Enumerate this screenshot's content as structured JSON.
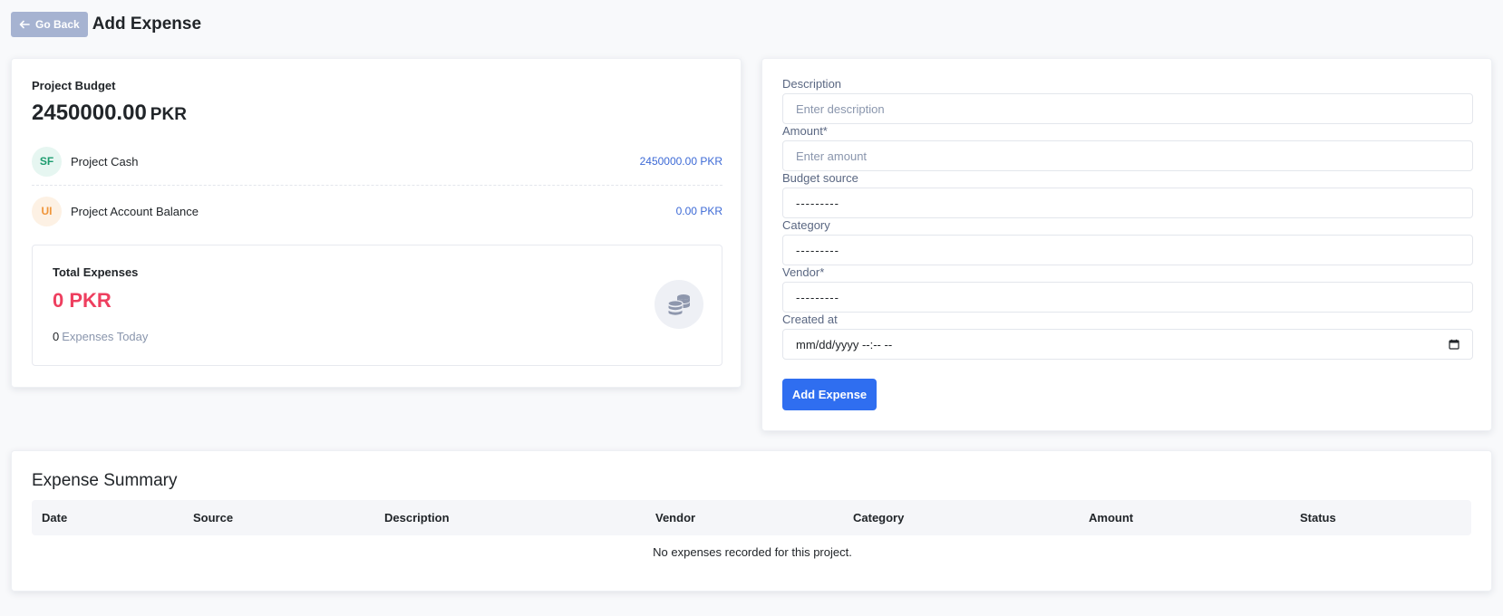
{
  "header": {
    "back_label": "Go Back",
    "title": "Add Expense"
  },
  "budget": {
    "label": "Project Budget",
    "value": "2450000.00",
    "currency": "PKR",
    "accounts": [
      {
        "initials": "SF",
        "name": "Project Cash",
        "amount": "2450000.00 PKR"
      },
      {
        "initials": "UI",
        "name": "Project Account Balance",
        "amount": "0.00 PKR"
      }
    ],
    "total": {
      "label": "Total Expenses",
      "value": "0 PKR",
      "today_count": "0",
      "today_label": "Expenses Today",
      "icon": "coins-icon"
    }
  },
  "form": {
    "description": {
      "label": "Description",
      "placeholder": "Enter description"
    },
    "amount": {
      "label": "Amount*",
      "placeholder": "Enter amount"
    },
    "budget_source": {
      "label": "Budget source",
      "value": "---------"
    },
    "category": {
      "label": "Category",
      "value": "---------"
    },
    "vendor": {
      "label": "Vendor*",
      "value": "---------"
    },
    "created_at": {
      "label": "Created at",
      "value": "mm/dd/yyyy --:-- --"
    },
    "submit_label": "Add Expense"
  },
  "summary": {
    "title": "Expense Summary",
    "columns": [
      "Date",
      "Source",
      "Description",
      "Vendor",
      "Category",
      "Amount",
      "Status"
    ],
    "empty_message": "No expenses recorded for this project."
  },
  "colors": {
    "accent": "#2f6ef0",
    "back_button": "#a6b3d1",
    "expense_red": "#ee3f5f",
    "amount_blue": "#3d6ad6"
  }
}
